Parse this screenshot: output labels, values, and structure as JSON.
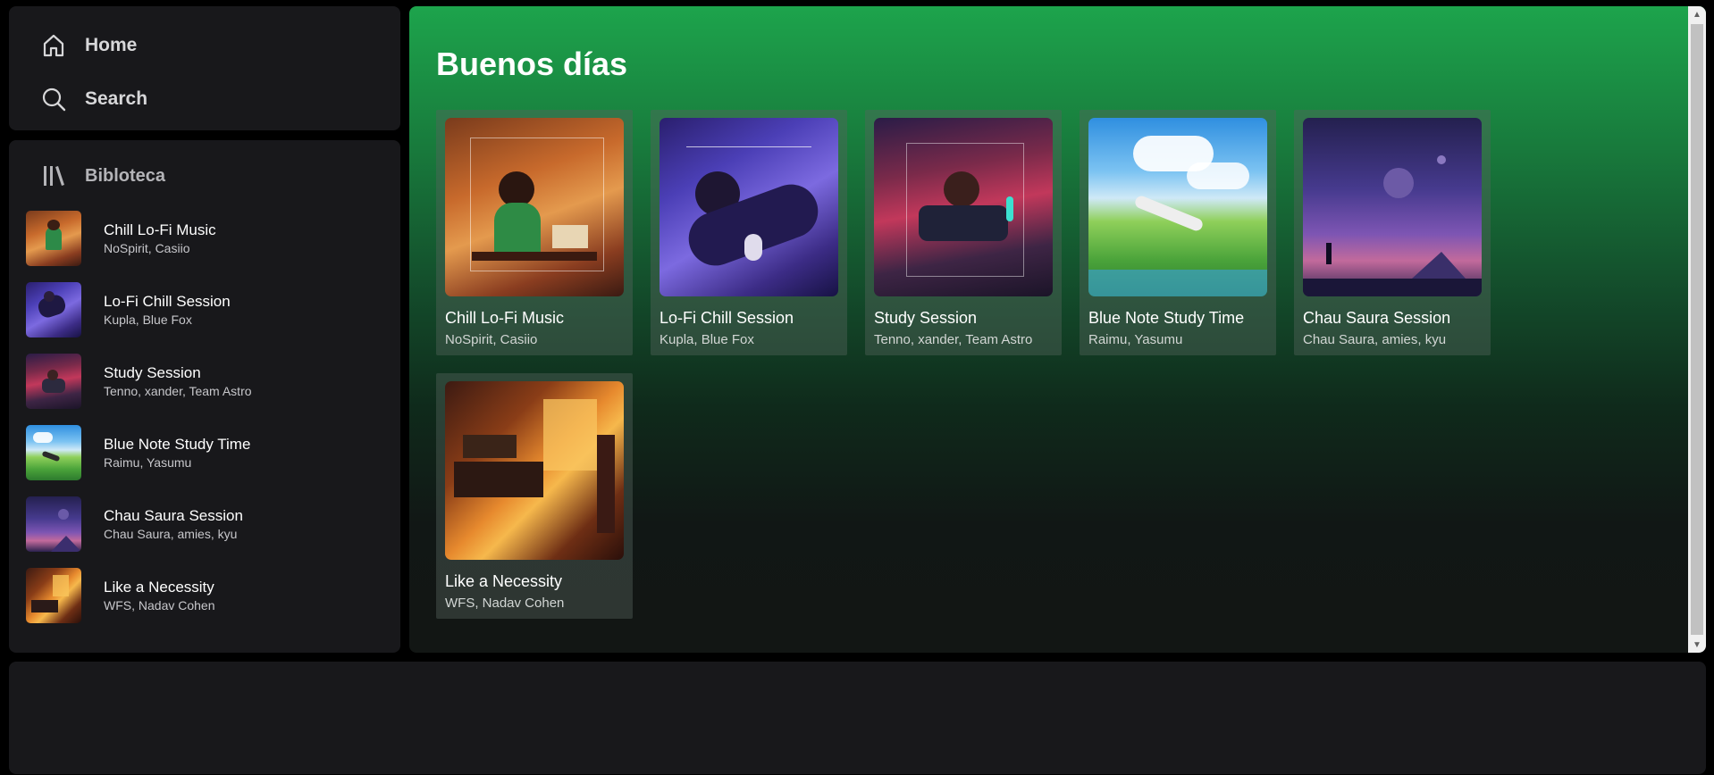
{
  "nav": {
    "home_label": "Home",
    "search_label": "Search"
  },
  "library": {
    "title": "Bibloteca",
    "items": [
      {
        "title": "Chill Lo-Fi Music",
        "subtitle": "NoSpirit, Casiio"
      },
      {
        "title": "Lo-Fi Chill Session",
        "subtitle": "Kupla, Blue Fox"
      },
      {
        "title": "Study Session",
        "subtitle": "Tenno, xander, Team Astro"
      },
      {
        "title": "Blue Note Study Time",
        "subtitle": "Raimu, Yasumu"
      },
      {
        "title": "Chau Saura Session",
        "subtitle": "Chau Saura, amies, kyu"
      },
      {
        "title": "Like a Necessity",
        "subtitle": "WFS, Nadav Cohen"
      }
    ]
  },
  "main": {
    "greeting": "Buenos días",
    "cards": [
      {
        "title": "Chill Lo-Fi Music",
        "subtitle": "NoSpirit, Casiio"
      },
      {
        "title": "Lo-Fi Chill Session",
        "subtitle": "Kupla, Blue Fox"
      },
      {
        "title": "Study Session",
        "subtitle": "Tenno, xander, Team Astro"
      },
      {
        "title": "Blue Note Study Time",
        "subtitle": "Raimu, Yasumu"
      },
      {
        "title": "Chau Saura Session",
        "subtitle": "Chau Saura, amies, kyu"
      },
      {
        "title": "Like a Necessity",
        "subtitle": "WFS, Nadav Cohen"
      }
    ]
  },
  "icons": {
    "home": "home-icon",
    "search": "search-icon",
    "library": "library-icon"
  },
  "colors": {
    "panel_bg": "#18181b",
    "accent_green": "#1da44c",
    "page_bg": "#000000"
  }
}
